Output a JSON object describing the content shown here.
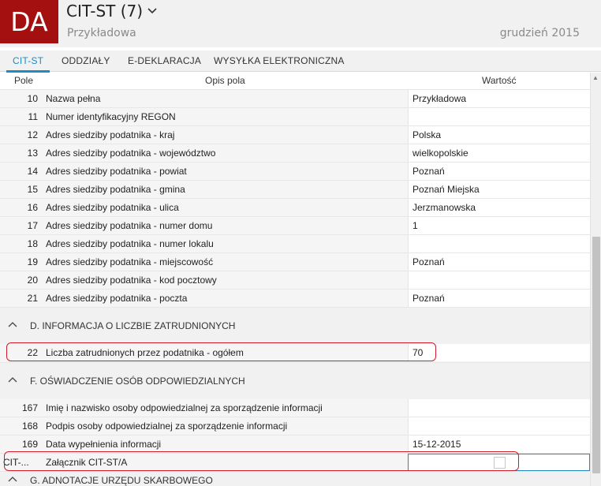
{
  "header": {
    "logo": "DA",
    "title": "CIT-ST (7)",
    "subtitle": "Przykładowa",
    "period": "grudzień 2015"
  },
  "tabs": [
    {
      "label": "CIT-ST",
      "active": true
    },
    {
      "label": "ODDZIAŁY",
      "active": false
    },
    {
      "label": "E-DEKLARACJA",
      "active": false
    },
    {
      "label": "WYSYŁKA ELEKTRONICZNA",
      "active": false
    }
  ],
  "columns": {
    "pole": "Pole",
    "opis": "Opis pola",
    "wartosc": "Wartość"
  },
  "rows_c": [
    {
      "num": "10",
      "desc": "Nazwa pełna",
      "val": "Przykładowa"
    },
    {
      "num": "11",
      "desc": "Numer identyfikacyjny REGON",
      "val": ""
    },
    {
      "num": "12",
      "desc": "Adres siedziby podatnika - kraj",
      "val": "Polska"
    },
    {
      "num": "13",
      "desc": "Adres siedziby podatnika - województwo",
      "val": "wielkopolskie"
    },
    {
      "num": "14",
      "desc": "Adres siedziby podatnika - powiat",
      "val": "Poznań"
    },
    {
      "num": "15",
      "desc": "Adres siedziby podatnika - gmina",
      "val": "Poznań Miejska"
    },
    {
      "num": "16",
      "desc": "Adres siedziby podatnika - ulica",
      "val": "Jerzmanowska"
    },
    {
      "num": "17",
      "desc": "Adres siedziby podatnika - numer domu",
      "val": "1"
    },
    {
      "num": "18",
      "desc": "Adres siedziby podatnika - numer lokalu",
      "val": ""
    },
    {
      "num": "19",
      "desc": "Adres siedziby podatnika - miejscowość",
      "val": "Poznań"
    },
    {
      "num": "20",
      "desc": "Adres siedziby podatnika - kod pocztowy",
      "val": ""
    },
    {
      "num": "21",
      "desc": "Adres siedziby podatnika - poczta",
      "val": "Poznań"
    }
  ],
  "section_d": {
    "label": "D. INFORMACJA O LICZBIE ZATRUDNIONYCH"
  },
  "rows_d": [
    {
      "num": "22",
      "desc": "Liczba zatrudnionych przez podatnika - ogółem",
      "val": "70"
    }
  ],
  "section_f": {
    "label": "F. OŚWIADCZENIE OSÓB ODPOWIEDZIALNYCH"
  },
  "rows_f": [
    {
      "num": "167",
      "desc": "Imię i nazwisko osoby odpowiedzialnej za sporządzenie informacji",
      "val": ""
    },
    {
      "num": "168",
      "desc": "Podpis osoby odpowiedzialnej za sporządzenie informacji",
      "val": ""
    },
    {
      "num": "169",
      "desc": "Data wypełnienia informacji",
      "val": "15-12-2015"
    },
    {
      "num": "CIT-...",
      "desc": "Załącznik CIT-ST/A",
      "val": ""
    }
  ],
  "section_g": {
    "label": "G. ADNOTACJE URZĘDU SKARBOWEGO"
  },
  "colors": {
    "brand": "#a4100f",
    "accent": "#1e8bc3",
    "highlight": "#d01b2a"
  },
  "icons": {
    "title_dropdown": "chevron-down-icon",
    "section_toggle": "chevron-up-icon"
  }
}
